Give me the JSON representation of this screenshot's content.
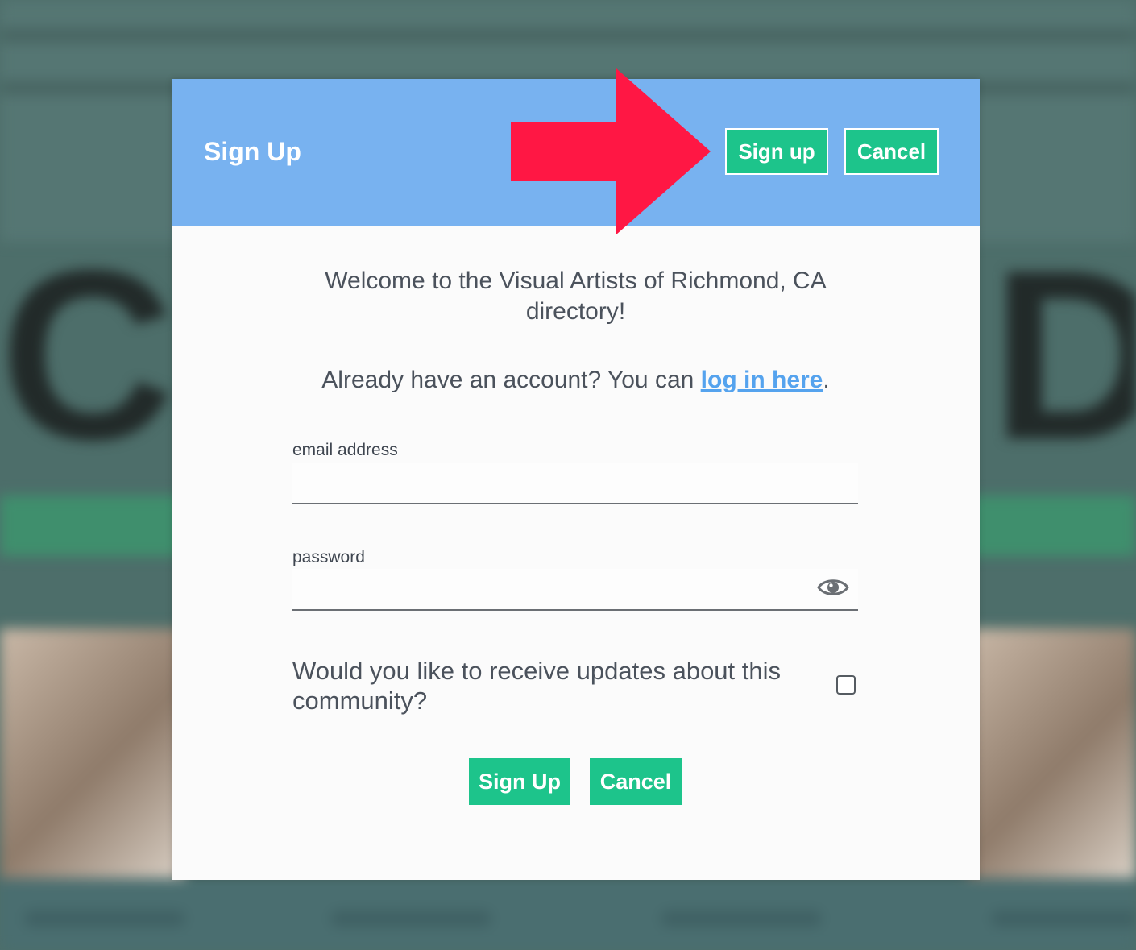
{
  "modal": {
    "title": "Sign Up",
    "header_buttons": {
      "signup_label": "Sign up",
      "cancel_label": "Cancel"
    },
    "welcome_text": "Welcome to the Visual Artists of Richmond, CA directory!",
    "account_prompt": {
      "prefix": "Already have an account? You can ",
      "link_text": "log in here",
      "suffix": "."
    },
    "email": {
      "label": "email address",
      "value": "",
      "placeholder": ""
    },
    "password": {
      "label": "password",
      "value": "",
      "placeholder": ""
    },
    "updates": {
      "question": "Would you like to receive updates about this community?",
      "checked": false
    },
    "footer_buttons": {
      "signup_label": "Sign Up",
      "cancel_label": "Cancel"
    }
  },
  "icons": {
    "password_toggle": "eye-icon",
    "callout": "arrow-right-icon"
  },
  "colors": {
    "header": "#78b2f0",
    "button": "#1dc48b",
    "link": "#55a3ee",
    "arrow": "#ff1744"
  }
}
